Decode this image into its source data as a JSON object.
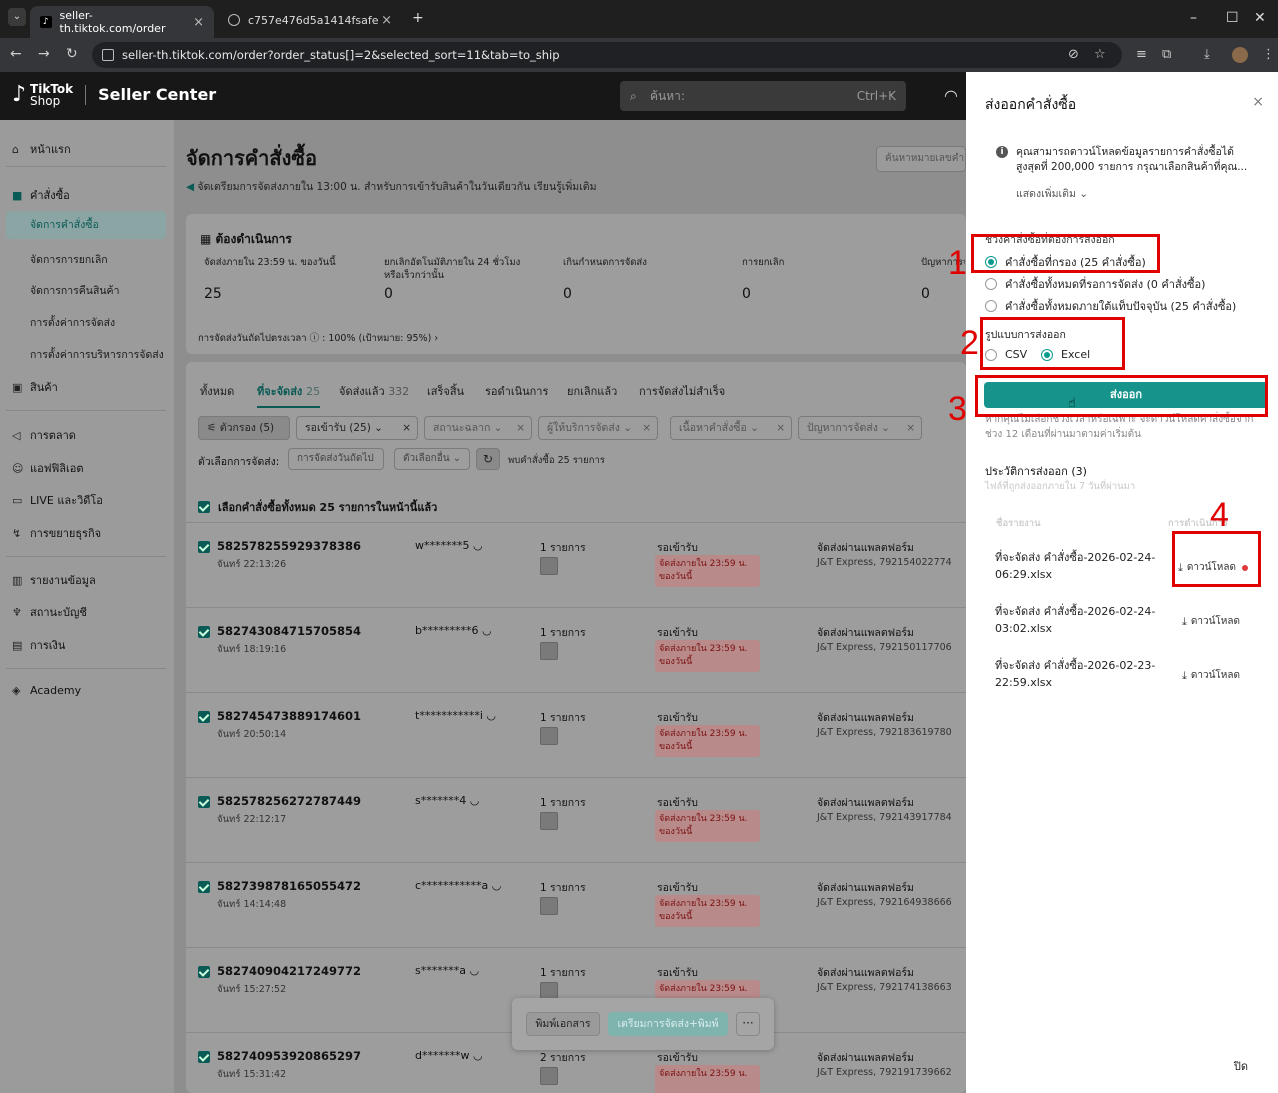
{
  "browser": {
    "tabs": [
      {
        "title": "seller-th.tiktok.com/order"
      },
      {
        "title": "c757e476d5a1414fsafe"
      }
    ],
    "new_tab": "+",
    "url": "seller-th.tiktok.com/order?order_status[]=2&selected_sort=11&tab=to_ship"
  },
  "header": {
    "brand_top": "TikTok",
    "brand_bottom": "Shop",
    "product": "Seller Center",
    "search_placeholder": "ค้นหา:",
    "search_shortcut": "Ctrl+K"
  },
  "sidebar": {
    "home": "หน้าแรก",
    "orders": "คำสั่งซื้อ",
    "order_sub": [
      "จัดการคำสั่งซื้อ",
      "จัดการการยกเลิก",
      "จัดการการคืนสินค้า",
      "การตั้งค่าการจัดส่ง",
      "การตั้งค่าการบริหารการจัดส่ง"
    ],
    "products": "สินค้า",
    "marketing": "การตลาด",
    "affiliate": "แอฟฟิลิเอต",
    "live_video": "LIVE และวิดีโอ",
    "growth": "การขยายธุรกิจ",
    "data": "รายงานข้อมูล",
    "account": "สถานะบัญชี",
    "finance": "การเงิน",
    "academy": "Academy"
  },
  "page": {
    "title": "จัดการคำสั่งซื้อ",
    "notice": "จัดเตรียมการจัดส่งภายใน 13:00 น. สำหรับการเข้ารับสินค้าในวันเดียวกัน เรียนรู้เพิ่มเติม",
    "order_search": "ค้นหาหมายเลขคำสั่งซื้อ"
  },
  "todo": {
    "title": "ต้องดำเนินการ",
    "stats": [
      {
        "label": "จัดส่งภายใน 23:59 น. ของวันนี้",
        "value": "25"
      },
      {
        "label": "ยกเลิกอัตโนมัติภายใน 24 ชั่วโมงหรือเร็วกว่านั้น",
        "value": "0"
      },
      {
        "label": "เกินกำหนดการจัดส่ง",
        "value": "0"
      },
      {
        "label": "การยกเลิก",
        "value": "0"
      },
      {
        "label": "ปัญหาการจัดส่ง",
        "value": "0"
      }
    ],
    "ship_rate": "การจัดส่งวันถัดไปตรงเวลา ⓘ : 100% (เป้าหมาย: 95%)  ›"
  },
  "tabs": [
    {
      "label": "ทั้งหมด",
      "count": ""
    },
    {
      "label": "ที่จะจัดส่ง",
      "count": "25"
    },
    {
      "label": "จัดส่งแล้ว",
      "count": "332"
    },
    {
      "label": "เสร็จสิ้น",
      "count": ""
    },
    {
      "label": "รอดำเนินการ",
      "count": ""
    },
    {
      "label": "ยกเลิกแล้ว",
      "count": ""
    },
    {
      "label": "การจัดส่งไม่สำเร็จ",
      "count": ""
    }
  ],
  "filters": {
    "filter_btn": "ตัวกรอง (5)",
    "awaiting": "รอเข้ารับ (25)",
    "label_status": "สถานะฉลาก",
    "carrier": "ผู้ให้บริการจัดส่ง",
    "content": "เนื้อหาคำสั่งซื้อ",
    "problem": "ปัญหาการจัดส่ง",
    "options_label": "ตัวเลือกการจัดส่ง:",
    "next_day": "การจัดส่งวันถัดไป",
    "other": "ตัวเลือกอื่น",
    "found": "พบคำสั่งซื้อ 25 รายการ"
  },
  "select_all": "เลือกคำสั่งซื้อทั้งหมด 25 รายการในหน้านี้แล้ว",
  "orders": [
    {
      "id": "582578255929378386",
      "date": "จันทร์ 22:13:26",
      "buyer": "w*******5",
      "items": "1 รายการ",
      "status": "รอเข้ารับ",
      "deadline": "จัดส่งภายใน 23:59 น. ของวันนี้",
      "ship": "จัดส่งผ่านแพลตฟอร์ม",
      "track": "J&T Express, 792154022774"
    },
    {
      "id": "582743084715705854",
      "date": "จันทร์ 18:19:16",
      "buyer": "b*********6",
      "items": "1 รายการ",
      "status": "รอเข้ารับ",
      "deadline": "จัดส่งภายใน 23:59 น. ของวันนี้",
      "ship": "จัดส่งผ่านแพลตฟอร์ม",
      "track": "J&T Express, 792150117706"
    },
    {
      "id": "582745473889174601",
      "date": "จันทร์ 20:50:14",
      "buyer": "t***********i",
      "items": "1 รายการ",
      "status": "รอเข้ารับ",
      "deadline": "จัดส่งภายใน 23:59 น. ของวันนี้",
      "ship": "จัดส่งผ่านแพลตฟอร์ม",
      "track": "J&T Express, 792183619780"
    },
    {
      "id": "582578256272787449",
      "date": "จันทร์ 22:12:17",
      "buyer": "s*******4",
      "items": "1 รายการ",
      "status": "รอเข้ารับ",
      "deadline": "จัดส่งภายใน 23:59 น. ของวันนี้",
      "ship": "จัดส่งผ่านแพลตฟอร์ม",
      "track": "J&T Express, 792143917784"
    },
    {
      "id": "582739878165055472",
      "date": "จันทร์ 14:14:48",
      "buyer": "c***********a",
      "items": "1 รายการ",
      "status": "รอเข้ารับ",
      "deadline": "จัดส่งภายใน 23:59 น. ของวันนี้",
      "ship": "จัดส่งผ่านแพลตฟอร์ม",
      "track": "J&T Express, 792164938666"
    },
    {
      "id": "582740904217249772",
      "date": "จันทร์ 15:27:52",
      "buyer": "s*******a",
      "items": "1 รายการ",
      "status": "รอเข้ารับ",
      "deadline": "จัดส่งภายใน 23:59 น.",
      "ship": "จัดส่งผ่านแพลตฟอร์ม",
      "track": "J&T Express, 792174138663"
    },
    {
      "id": "582740953920865297",
      "date": "จันทร์ 15:31:42",
      "buyer": "d*******w",
      "items": "2 รายการ",
      "status": "รอเข้ารับ",
      "deadline": "จัดส่งภายใน 23:59 น.",
      "ship": "จัดส่งผ่านแพลตฟอร์ม",
      "track": "J&T Express, 792191739662"
    }
  ],
  "bulk": {
    "print": "พิมพ์เอกสาร",
    "prepare": "เตรียมการจัดส่ง+พิมพ์",
    "more": "···"
  },
  "drawer": {
    "title": "ส่งออกคำสั่งซื้อ",
    "close": "×",
    "info": "คุณสามารถดาวน์โหลดข้อมูลรายการคำสั่งซื้อได้สูงสุดที่ 200,000 รายการ กรุณาเลือกสินค้าที่คุณ...",
    "show_more": "แสดงเพิ่มเติม ⌄",
    "range_label": "ช่วงคำสั่งซื้อที่ต้องการส่งออก",
    "range_options": [
      "คำสั่งซื้อที่กรอง (25 คำสั่งซื้อ)",
      "คำสั่งซื้อทั้งหมดที่รอการจัดส่ง (0 คำสั่งซื้อ)",
      "คำสั่งซื้อทั้งหมดภายใต้แท็บปัจจุบัน (25 คำสั่งซื้อ)"
    ],
    "format_label": "รูปแบบการส่งออก",
    "formats": [
      "CSV",
      "Excel"
    ],
    "export_btn": "ส่งออก",
    "export_note": "หากคุณไม่เลือกช่วงเวลาหรือเฉพาะ จะดาวน์โหลดคำสั่งซื้อจากช่วง 12 เดือนที่ผ่านมาตามค่าเริ่มต้น",
    "history_title": "ประวัติการส่งออก (3)",
    "history_sub": "ไฟล์ที่ถูกส่งออกภายใน 7 วันที่ผ่านมา",
    "col_name": "ชื่อรายงาน",
    "col_action": "การดำเนินการ",
    "history": [
      {
        "file": "ที่จะจัดส่ง คำสั่งซื้อ-2026-02-24-06:29.xlsx",
        "action": "ดาวน์โหลด"
      },
      {
        "file": "ที่จะจัดส่ง คำสั่งซื้อ-2026-02-24-03:02.xlsx",
        "action": "ดาวน์โหลด"
      },
      {
        "file": "ที่จะจัดส่ง คำสั่งซื้อ-2026-02-23-22:59.xlsx",
        "action": "ดาวน์โหลด"
      }
    ],
    "footer_close": "ปิด"
  },
  "annotations": [
    "1",
    "2",
    "3",
    "4"
  ]
}
